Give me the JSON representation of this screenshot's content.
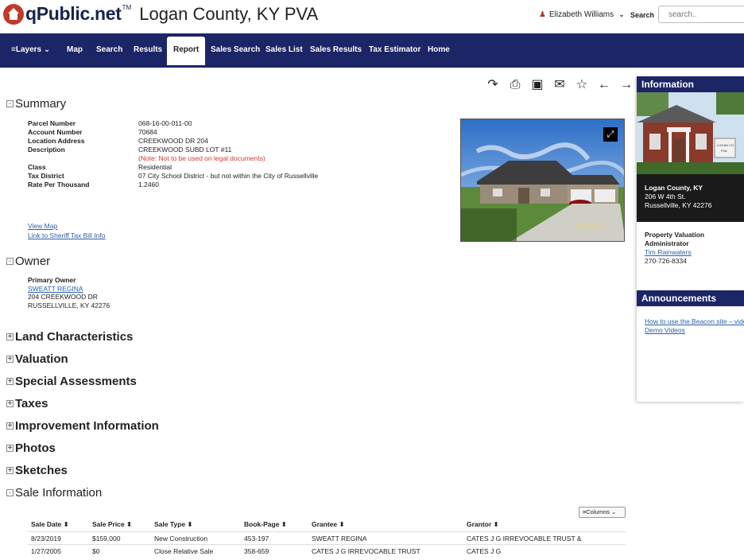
{
  "header": {
    "logo": "qPublic.net",
    "trademark": "TM",
    "title": "Logan County, KY PVA",
    "user": "Elizabeth Williams",
    "search_label": "Search",
    "search_placeholder": "search.."
  },
  "nav": {
    "layers": "Layers",
    "map": "Map",
    "search": "Search",
    "results": "Results",
    "report": "Report",
    "sales_search": "Sales Search",
    "sales_list": "Sales List",
    "sales_results": "Sales Results",
    "tax_estimator": "Tax Estimator",
    "home": "Home"
  },
  "summary": {
    "title": "Summary",
    "parcel_label": "Parcel Number",
    "parcel": "068-16-00-011-00",
    "account_label": "Account Number",
    "account": "70684",
    "location_label": "Location Address",
    "location": "CREEKWOOD DR 204",
    "description_label": "Description",
    "description": "CREEKWOOD SUBD LOT #11",
    "note": "(Note: Not to be used on legal documents)",
    "class_label": "Class",
    "class": "Residential",
    "district_label": "Tax District",
    "district": "07 City School District - but not within the City of Russellville",
    "rate_label": "Rate Per Thousand",
    "rate": "1.2460",
    "view_map": "View Map",
    "sheriff_link": "Link to Sheriff Tax Bill Info"
  },
  "owner": {
    "title": "Owner",
    "label": "Primary Owner",
    "name": "SWEATT REGINA",
    "address1": "204 CREEKWOOD DR",
    "address2": "RUSSELLVILLE, KY 42276"
  },
  "sections": {
    "land": "Land Characteristics",
    "valuation": "Valuation",
    "special": "Special Assessments",
    "taxes": "Taxes",
    "improvement": "Improvement Information",
    "photos": "Photos",
    "sketches": "Sketches",
    "sale": "Sale Information"
  },
  "sales": {
    "columns_btn": "Columns",
    "headers": [
      "Sale Date",
      "Sale Price",
      "Sale Type",
      "Book-Page",
      "Grantee",
      "Grantor"
    ],
    "rows": [
      [
        "8/23/2019",
        "$159,000",
        "New Construction",
        "453-197",
        "SWEATT REGINA",
        "CATES J G IRREVOCABLE TRUST &"
      ],
      [
        "1/27/2005",
        "$0",
        "Close Relative Sale",
        "358-659",
        "CATES J G IRREVOCABLE TRUST",
        "CATES J G"
      ]
    ]
  },
  "photo": {
    "date_stamp": "01.09.2019"
  },
  "sidebar": {
    "info_title": "Information",
    "county": "Logan County, KY",
    "street": "206 W 4th St.",
    "city": "Russellville, KY 42276",
    "pva_line1": "Property Valuation",
    "pva_line2": "Administrator",
    "pva_name": "Tim Rainwaters",
    "phone": "270-726-8334",
    "ann_title": "Announcements",
    "ann_link1": "How to use the Beacon site – video",
    "ann_link2": "Demo Videos",
    "sign_line1": "LOGAN CO.",
    "sign_line2": "PVA"
  },
  "colors": {
    "navy": "#1c2565",
    "link": "#2b5fa8",
    "note": "#d03a30"
  }
}
